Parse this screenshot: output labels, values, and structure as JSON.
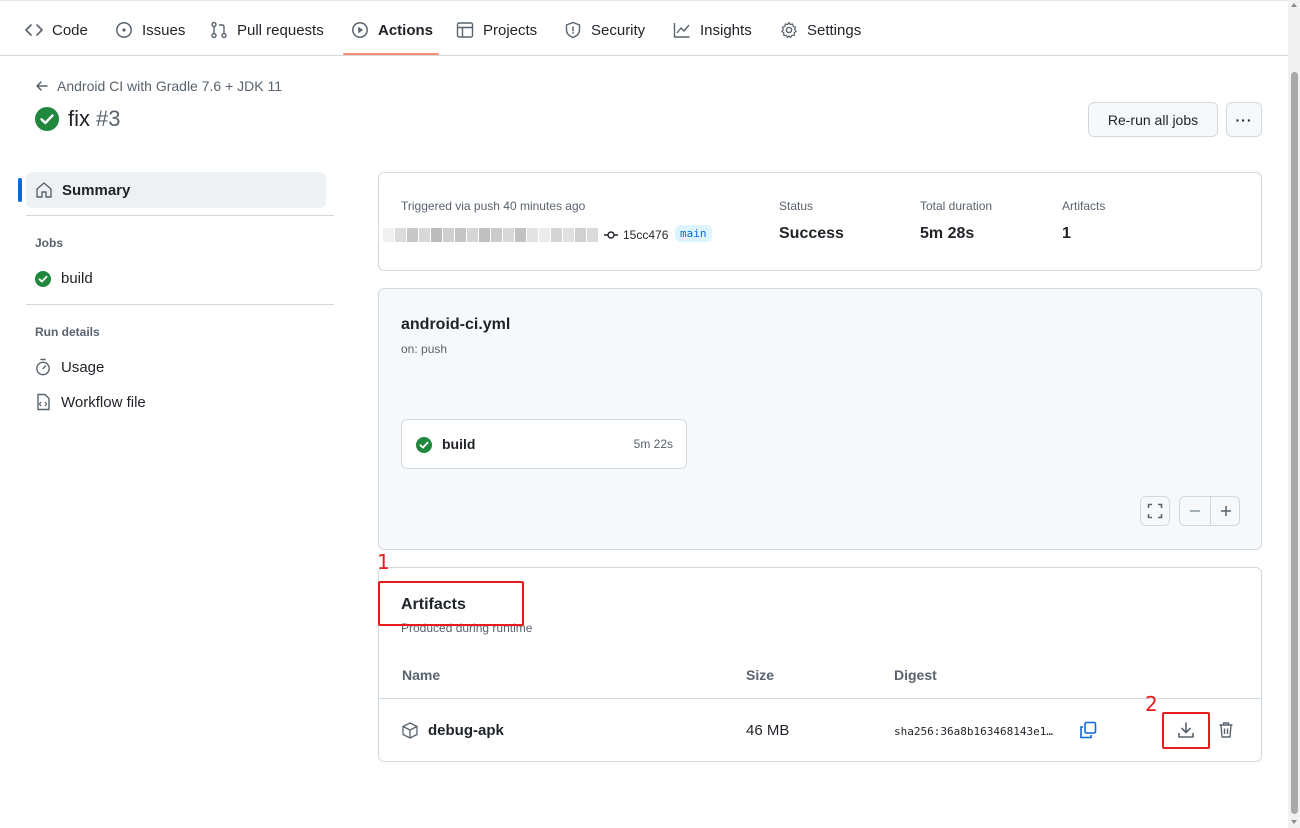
{
  "nav": {
    "tabs": [
      {
        "label": "Code",
        "icon": "code-icon"
      },
      {
        "label": "Issues",
        "icon": "issue-icon"
      },
      {
        "label": "Pull requests",
        "icon": "pull-request-icon"
      },
      {
        "label": "Actions",
        "icon": "play-icon",
        "active": true
      },
      {
        "label": "Projects",
        "icon": "table-icon"
      },
      {
        "label": "Security",
        "icon": "shield-icon"
      },
      {
        "label": "Insights",
        "icon": "graph-icon"
      },
      {
        "label": "Settings",
        "icon": "gear-icon"
      }
    ]
  },
  "header": {
    "workflow_name": "Android CI with Gradle 7.6 + JDK 11",
    "run_title": "fix",
    "run_number": "#3",
    "rerun_label": "Re-run all jobs",
    "more_label": "···"
  },
  "sidebar": {
    "summary_label": "Summary",
    "jobs_heading": "Jobs",
    "job_label": "build",
    "run_details_heading": "Run details",
    "usage_label": "Usage",
    "workflow_file_label": "Workflow file"
  },
  "summary": {
    "triggered_label": "Triggered via push 40 minutes ago",
    "commit_sha": "15cc476",
    "branch": "main",
    "status_label": "Status",
    "status_value": "Success",
    "duration_label": "Total duration",
    "duration_value": "5m 28s",
    "artifacts_label": "Artifacts",
    "artifacts_value": "1"
  },
  "workflow": {
    "file_name": "android-ci.yml",
    "trigger": "on: push",
    "job_name": "build",
    "job_duration": "5m 22s"
  },
  "artifacts": {
    "title": "Artifacts",
    "subtitle": "Produced during runtime",
    "columns": [
      "Name",
      "Size",
      "Digest"
    ],
    "rows": [
      {
        "name": "debug-apk",
        "size": "46 MB",
        "digest": "sha256:36a8b163468143e1…"
      }
    ]
  },
  "annotations": {
    "marker_1": "1",
    "marker_2": "2"
  },
  "colors": {
    "success": "#1f883d",
    "accent": "#0969da",
    "tab_underline": "#fd8c73",
    "annotation": "#e81c1c"
  }
}
